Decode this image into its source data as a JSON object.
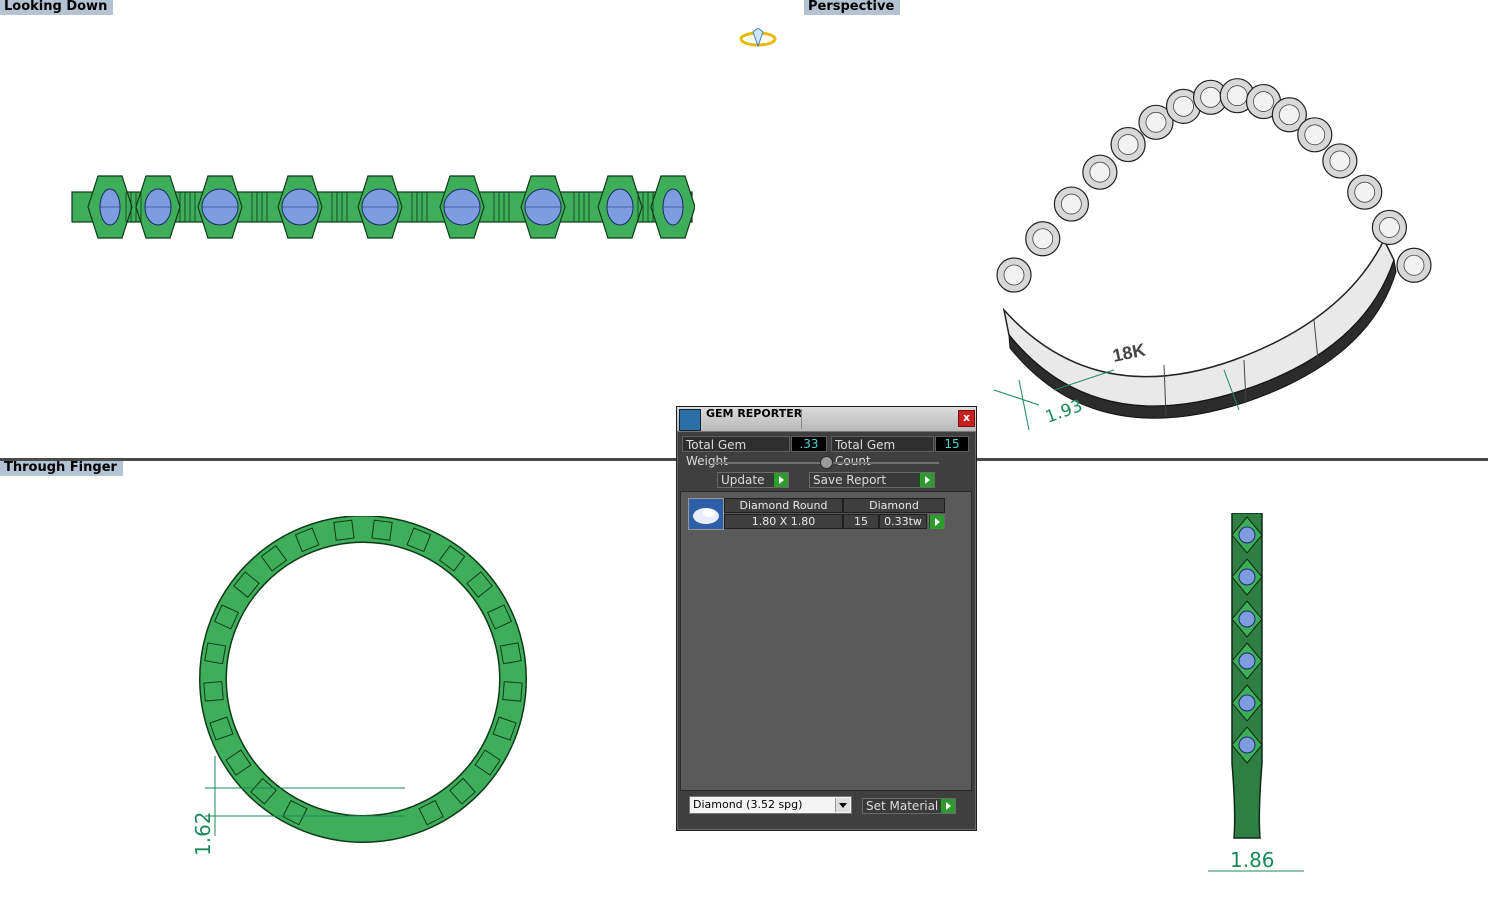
{
  "viewports": {
    "top_left": {
      "label": "Looking Down"
    },
    "top_right": {
      "label": "Perspective"
    },
    "bottom_left": {
      "label": "Through Finger"
    },
    "bottom_right": {
      "label": ""
    }
  },
  "dimensions": {
    "perspective_dim": "1.93",
    "through_finger_dim": "1.62",
    "side_dim": "1.86",
    "engraving": "18K"
  },
  "gem_reporter": {
    "title": "GEM REPORTER",
    "close_label": "x",
    "total_gem_weight_label": "Total Gem Weight",
    "total_gem_weight_value": ".33",
    "total_gem_count_label": "Total Gem Count",
    "total_gem_count_value": "15",
    "update_label": "Update",
    "save_report_label": "Save Report",
    "gems": [
      {
        "shape": "Diamond Round",
        "material": "Diamond",
        "size": "1.80 X 1.80",
        "count": "15",
        "weight": "0.33tw"
      }
    ],
    "material_select": "Diamond     (3.52 spg)",
    "set_material_label": "Set Material"
  },
  "colors": {
    "metal_green": "#3fae5a",
    "gem_blue": "#7d9de0",
    "dim_green": "#1a8a5a",
    "label_bg": "#b4c3d4"
  }
}
